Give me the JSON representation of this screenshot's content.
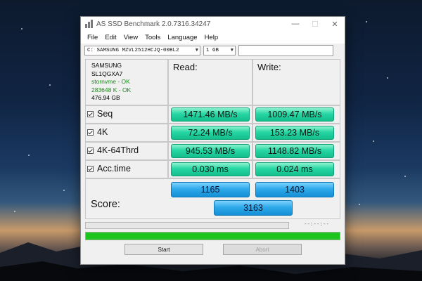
{
  "window": {
    "title": "AS SSD Benchmark 2.0.7316.34247"
  },
  "menu": [
    "File",
    "Edit",
    "View",
    "Tools",
    "Language",
    "Help"
  ],
  "drive": {
    "selected": "C: SAMSUNG MZVL2512HCJQ-00BL2",
    "size": "1 GB"
  },
  "info": {
    "vendor": "SAMSUNG",
    "model": "SL1QGXA7",
    "driver": "stornvme - OK",
    "alignment": "283648 K - OK",
    "capacity": "476.94 GB"
  },
  "headers": {
    "read": "Read:",
    "write": "Write:"
  },
  "rows": [
    {
      "label": "Seq",
      "read": "1471.46 MB/s",
      "write": "1009.47 MB/s"
    },
    {
      "label": "4K",
      "read": "72.24 MB/s",
      "write": "153.23 MB/s"
    },
    {
      "label": "4K-64Thrd",
      "read": "945.53 MB/s",
      "write": "1148.82 MB/s"
    },
    {
      "label": "Acc.time",
      "read": "0.030 ms",
      "write": "0.024 ms"
    }
  ],
  "score": {
    "label": "Score:",
    "read": "1165",
    "write": "1403",
    "total": "3163"
  },
  "status": {
    "time": "--:--:--",
    "progress_top": 0,
    "progress_bottom": 1.0
  },
  "buttons": {
    "start": "Start",
    "abort": "Abort"
  }
}
